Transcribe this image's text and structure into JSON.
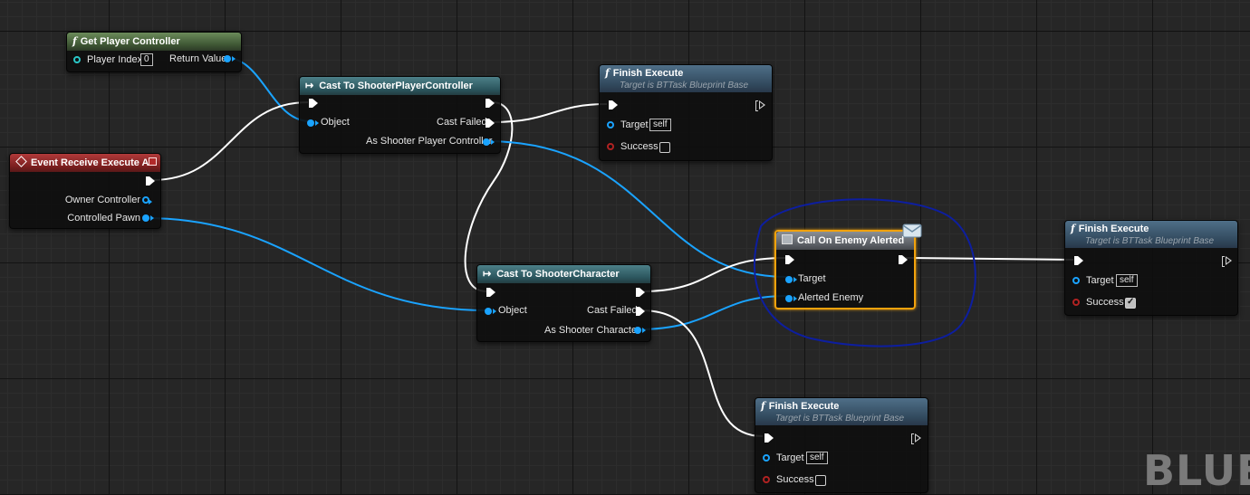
{
  "colors": {
    "exec_wire": "#ffffff",
    "object_wire": "#1aa3ff",
    "selection": "#f2a20c",
    "annotation": "#0d1ea0"
  },
  "nodes": {
    "get_player_controller": {
      "title": "Get Player Controller",
      "icon": "function-icon",
      "player_index_label": "Player Index",
      "player_index_value": "0",
      "return_label": "Return Value"
    },
    "cast_player_controller": {
      "title": "Cast To ShooterPlayerController",
      "icon": "cast-arrow-icon",
      "object_label": "Object",
      "cast_failed_label": "Cast Failed",
      "as_label": "As Shooter Player Controller"
    },
    "finish_execute_top": {
      "title": "Finish Execute",
      "subtitle": "Target is BTTask Blueprint Base",
      "target_label": "Target",
      "target_value": "self",
      "success_label": "Success",
      "success_checked": false
    },
    "event_receive": {
      "title": "Event Receive Execute AI",
      "icon": "event-diamond-icon",
      "owner_label": "Owner Controller",
      "pawn_label": "Controlled Pawn"
    },
    "call_on_enemy_alerted": {
      "title": "Call On Enemy Alerted",
      "icon": "event-dispatcher-icon",
      "target_label": "Target",
      "alerted_label": "Alerted Enemy"
    },
    "finish_execute_right": {
      "title": "Finish Execute",
      "subtitle": "Target is BTTask Blueprint Base",
      "target_label": "Target",
      "target_value": "self",
      "success_label": "Success",
      "success_checked": true
    },
    "cast_shooter_character": {
      "title": "Cast To ShooterCharacter",
      "icon": "cast-arrow-icon",
      "object_label": "Object",
      "cast_failed_label": "Cast Failed",
      "as_label": "As Shooter Character"
    },
    "finish_execute_bottom": {
      "title": "Finish Execute",
      "subtitle": "Target is BTTask Blueprint Base",
      "target_label": "Target",
      "target_value": "self",
      "success_label": "Success",
      "success_checked": false
    }
  },
  "watermark": "BLUE"
}
